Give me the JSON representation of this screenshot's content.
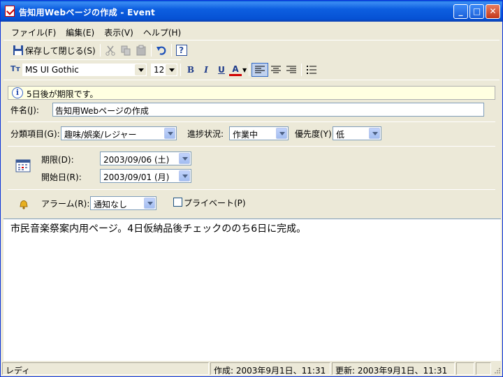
{
  "window": {
    "title": "告知用Webページの作成 - Event",
    "controls": {
      "minimize": "_",
      "maximize": "□",
      "close": "✕"
    }
  },
  "menu": {
    "items": [
      "ファイル(F)",
      "編集(E)",
      "表示(V)",
      "ヘルプ(H)"
    ]
  },
  "toolbar": {
    "save_close_label": "保存して閉じる(S)",
    "font_name": "MS UI Gothic",
    "font_size": "12",
    "bold": "B",
    "italic": "I",
    "underline": "U",
    "font_color": "A",
    "help": "?"
  },
  "info": {
    "text": "5日後が期限です。"
  },
  "subject": {
    "label": "件名(J):",
    "value": "告知用Webページの作成"
  },
  "category": {
    "label": "分類項目(G):",
    "value": "趣味/娯楽/レジャー"
  },
  "progress": {
    "label": "進捗状況:",
    "value": "作業中"
  },
  "priority": {
    "label": "優先度(Y):",
    "value": "低"
  },
  "due": {
    "label": "期限(D):",
    "value": "2003/09/06 (土)"
  },
  "start": {
    "label": "開始日(R):",
    "value": "2003/09/01 (月)"
  },
  "alarm": {
    "label": "アラーム(R):",
    "value": "通知なし"
  },
  "private": {
    "label": "プライベート(P)"
  },
  "body": {
    "text": "市民音楽祭案内用ページ。4日仮納品後チェックののち6日に完成。"
  },
  "status": {
    "ready": "レディ",
    "created": "作成:  2003年9月1日、11:31",
    "updated": "更新:  2003年9月1日、11:31"
  },
  "colors": {
    "titlebar": "#0a5fd8",
    "info_bg": "#ffffe1",
    "chrome": "#ece9d8"
  }
}
